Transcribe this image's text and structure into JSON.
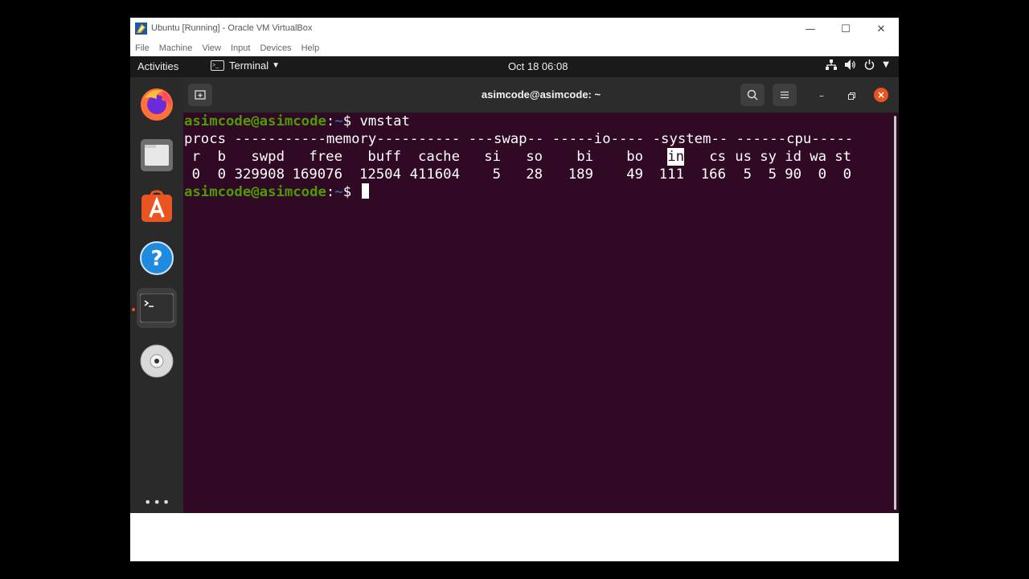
{
  "vbox": {
    "title": "Ubuntu [Running] - Oracle VM VirtualBox",
    "menu": [
      "File",
      "Machine",
      "View",
      "Input",
      "Devices",
      "Help"
    ],
    "controls": {
      "minimize": "—",
      "maximize": "☐",
      "close": "✕"
    }
  },
  "gnome": {
    "activities": "Activities",
    "app_menu": "Terminal",
    "clock": "Oct 18  06:08",
    "tray_icons": [
      "network-icon",
      "volume-icon",
      "power-icon",
      "chevron-down-icon"
    ]
  },
  "dock": {
    "apps": [
      "firefox-icon",
      "files-icon",
      "software-center-icon",
      "help-icon",
      "terminal-icon",
      "dvd-icon"
    ],
    "active_app": "terminal-icon",
    "show_apps_label": "•••"
  },
  "terminal": {
    "title": "asimcode@asimcode: ~",
    "accent": "#e95420",
    "background": "#300a24",
    "prompt_user": "asimcode@asimcode",
    "prompt_sep": ":",
    "prompt_path": "~",
    "prompt_dollar": "$",
    "command": "vmstat",
    "group_header": "procs -----------memory---------- ---swap-- -----io---- -system-- ------cpu-----",
    "columns": [
      "r",
      "b",
      "swpd",
      "free",
      "buff",
      "cache",
      "si",
      "so",
      "bi",
      "bo",
      "in",
      "cs",
      "us",
      "sy",
      "id",
      "wa",
      "st"
    ],
    "values": [
      "0",
      "0",
      "329908",
      "169076",
      "12504",
      "411604",
      "5",
      "28",
      "189",
      "49",
      "111",
      "166",
      "5",
      "5",
      "90",
      "0",
      "0"
    ],
    "highlighted_column": "in"
  }
}
